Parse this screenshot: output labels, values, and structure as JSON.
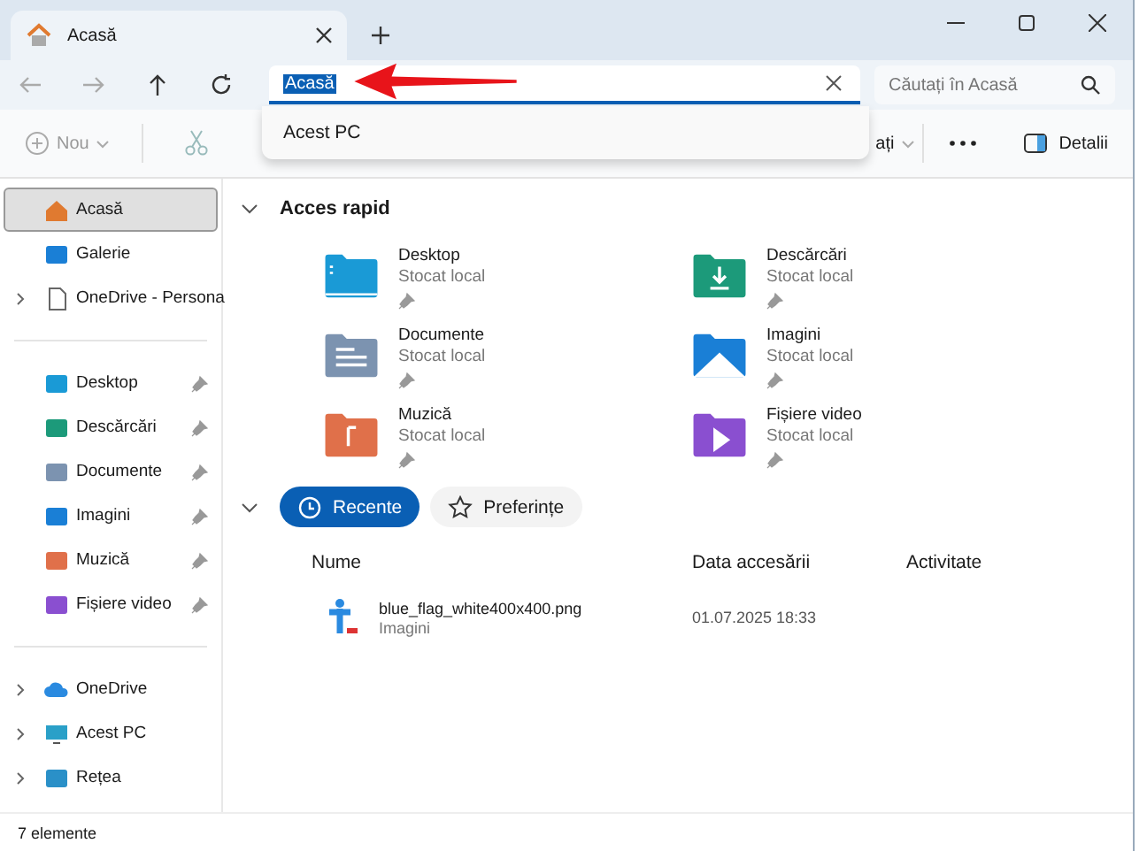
{
  "tab": {
    "label": "Acasă"
  },
  "address_bar": {
    "value": "Acasă",
    "text_selected": true
  },
  "search": {
    "placeholder": "Căutați în Acasă"
  },
  "address_suggestions": [
    {
      "label": "Acest PC"
    }
  ],
  "toolbar": {
    "new_label": "Nou",
    "sort_label": "ați",
    "details_label": "Detalii"
  },
  "sidebar": {
    "sections": [
      {
        "items": [
          {
            "label": "Acasă",
            "kind": "home",
            "selected": true,
            "expandable": false,
            "pinned": false
          },
          {
            "label": "Galerie",
            "kind": "gallery",
            "selected": false,
            "expandable": false,
            "pinned": false
          },
          {
            "label": "OneDrive - Persona",
            "kind": "file",
            "selected": false,
            "expandable": true,
            "pinned": false
          }
        ]
      },
      {
        "items": [
          {
            "label": "Desktop",
            "kind": "desktop",
            "selected": false,
            "expandable": false,
            "pinned": true
          },
          {
            "label": "Descărcări",
            "kind": "downloads",
            "selected": false,
            "expandable": false,
            "pinned": true
          },
          {
            "label": "Documente",
            "kind": "documents",
            "selected": false,
            "expandable": false,
            "pinned": true
          },
          {
            "label": "Imagini",
            "kind": "pictures",
            "selected": false,
            "expandable": false,
            "pinned": true
          },
          {
            "label": "Muzică",
            "kind": "music",
            "selected": false,
            "expandable": false,
            "pinned": true
          },
          {
            "label": "Fișiere video",
            "kind": "videos",
            "selected": false,
            "expandable": false,
            "pinned": true
          }
        ]
      },
      {
        "items": [
          {
            "label": "OneDrive",
            "kind": "cloud",
            "selected": false,
            "expandable": true,
            "pinned": false
          },
          {
            "label": "Acest PC",
            "kind": "pc",
            "selected": false,
            "expandable": true,
            "pinned": false
          },
          {
            "label": "Rețea",
            "kind": "network",
            "selected": false,
            "expandable": true,
            "pinned": false
          }
        ]
      }
    ]
  },
  "quick_access": {
    "title": "Acces rapid",
    "items": [
      {
        "name": "Desktop",
        "location": "Stocat local",
        "kind": "desktop",
        "pinned": true
      },
      {
        "name": "Descărcări",
        "location": "Stocat local",
        "kind": "downloads",
        "pinned": true
      },
      {
        "name": "Documente",
        "location": "Stocat local",
        "kind": "documents",
        "pinned": true
      },
      {
        "name": "Imagini",
        "location": "Stocat local",
        "kind": "pictures",
        "pinned": true
      },
      {
        "name": "Muzică",
        "location": "Stocat local",
        "kind": "music",
        "pinned": true
      },
      {
        "name": "Fișiere video",
        "location": "Stocat local",
        "kind": "videos",
        "pinned": true
      }
    ]
  },
  "recent_tabs": [
    {
      "label": "Recente",
      "kind": "clock",
      "selected": true
    },
    {
      "label": "Preferințe",
      "kind": "star",
      "selected": false
    }
  ],
  "table": {
    "columns": [
      "Nume",
      "Data accesării",
      "Activitate"
    ],
    "rows": [
      {
        "name": "blue_flag_white400x400.png",
        "location": "Imagini",
        "date": "01.07.2025 18:33"
      }
    ]
  },
  "status_bar": {
    "text": "7 elemente"
  }
}
